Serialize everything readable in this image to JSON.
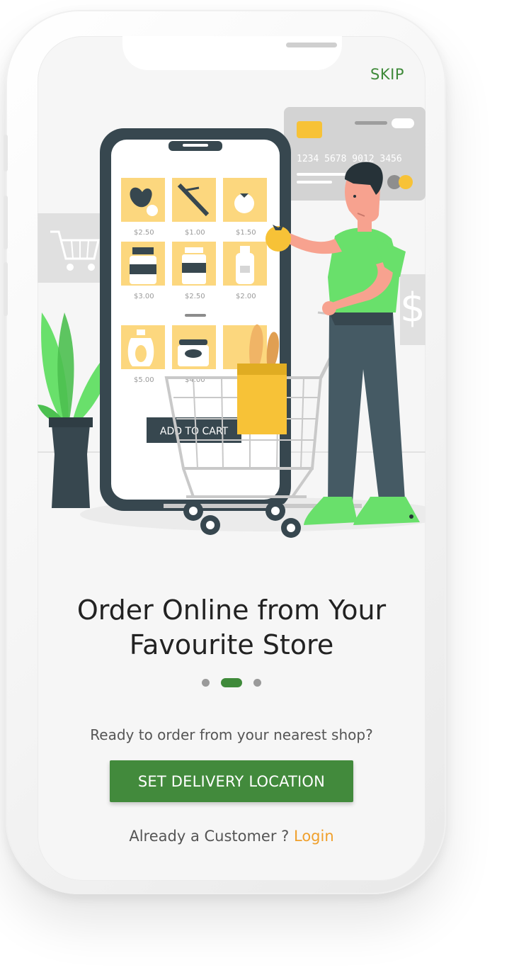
{
  "header": {
    "skip_label": "SKIP"
  },
  "illustration": {
    "card_number": "1234 5678 9012 3456",
    "product_prices": [
      "$2.50",
      "$1.00",
      "$1.50",
      "$3.00",
      "$2.50",
      "$2.00",
      "$5.00",
      "$4.00"
    ],
    "add_to_cart_label": "ADD TO CART"
  },
  "onboarding": {
    "title_line1": "Order Online from Your",
    "title_line2": "Favourite Store",
    "current_slide": 2,
    "total_slides": 3,
    "prompt": "Ready to order from your nearest shop?",
    "cta_label": "SET DELIVERY LOCATION",
    "login_prefix": "Already a Customer ?",
    "login_label": "Login"
  },
  "colors": {
    "primary_green": "#428a3c",
    "accent_orange": "#f0a02c",
    "illustration_yellow": "#fcd77e",
    "illustration_green": "#69e06b",
    "illustration_dark": "#37474f"
  }
}
